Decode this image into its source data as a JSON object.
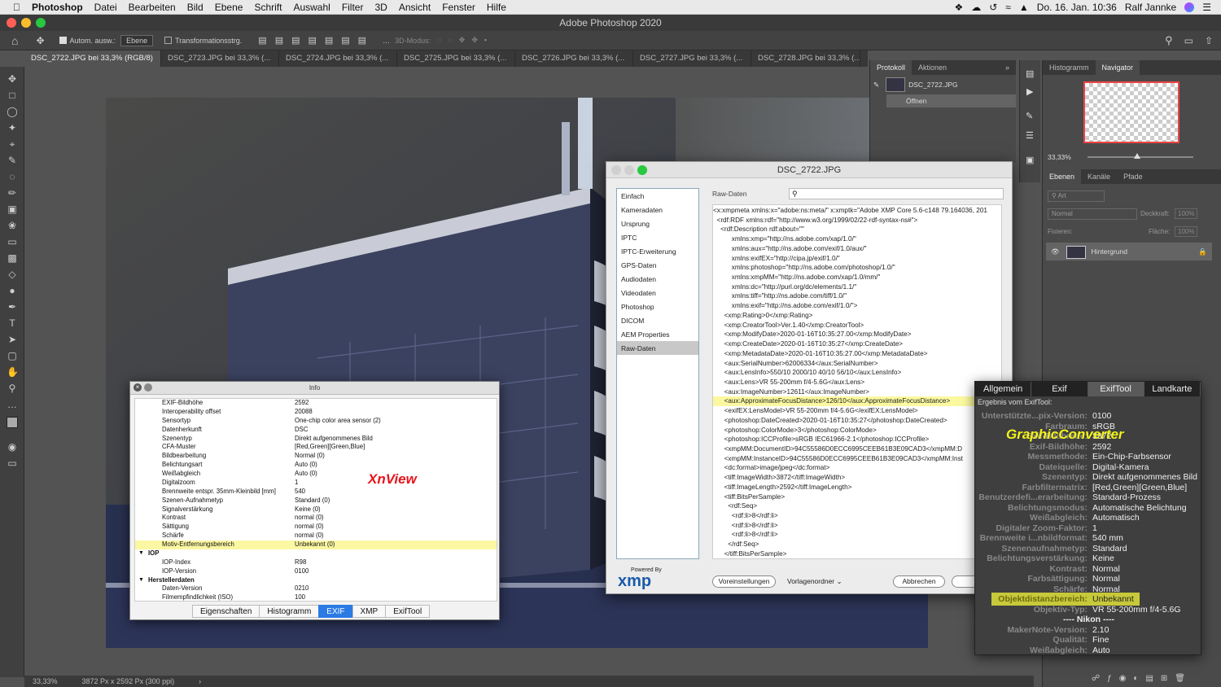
{
  "menubar": {
    "app": "Photoshop",
    "items": [
      "Datei",
      "Bearbeiten",
      "Bild",
      "Ebene",
      "Schrift",
      "Auswahl",
      "Filter",
      "3D",
      "Ansicht",
      "Fenster",
      "Hilfe"
    ],
    "datetime": "Do. 16. Jan. 10:36",
    "user": "Ralf Jannke"
  },
  "window": {
    "title": "Adobe Photoshop 2020"
  },
  "options": {
    "auto_select": "Autom. ausw.:",
    "layer_select": "Ebene",
    "transform": "Transformationsstrg.",
    "mode3d": "3D-Modus:"
  },
  "tabs": [
    "DSC_2722.JPG bei 33,3% (RGB/8)",
    "DSC_2723.JPG bei 33,3% (...",
    "DSC_2724.JPG bei 33,3% (...",
    "DSC_2725.JPG bei 33,3% (...",
    "DSC_2726.JPG bei 33,3% (...",
    "DSC_2727.JPG bei 33,3% (...",
    "DSC_2728.JPG bei 33,3% (..."
  ],
  "status": {
    "zoom": "33,33%",
    "dims": "3872 Px x 2592 Px (300 ppi)"
  },
  "protokoll": {
    "tab1": "Protokoll",
    "tab2": "Aktionen",
    "file": "DSC_2722.JPG",
    "step": "Öffnen"
  },
  "navigator": {
    "tab1": "Histogramm",
    "tab2": "Navigator",
    "zoom": "33,33%"
  },
  "layers": {
    "tabs": [
      "Ebenen",
      "Kanäle",
      "Pfade"
    ],
    "kind": "Art",
    "blend": "Normal",
    "opacity_label": "Deckkraft:",
    "opacity": "100%",
    "lock_label": "Fixieren:",
    "fill_label": "Fläche:",
    "fill": "100%",
    "layer": "Hintergrund"
  },
  "xmp": {
    "title": "DSC_2722.JPG",
    "nav": [
      "Einfach",
      "Kameradaten",
      "Ursprung",
      "IPTC",
      "IPTC-Erweiterung",
      "GPS-Daten",
      "Audiodaten",
      "Videodaten",
      "Photoshop",
      "DICOM",
      "AEM Properties",
      "Raw-Daten"
    ],
    "selected": "Raw-Daten",
    "section": "Raw-Daten",
    "powered": "Powered By",
    "logo": "xmp",
    "btn_prefs": "Voreinstellungen",
    "btn_templates": "Vorlagenordner",
    "btn_cancel": "Abbrechen",
    "lines": [
      "<x:xmpmeta xmlns:x=\"adobe:ns:meta/\" x:xmptk=\"Adobe XMP Core 5.6-c148 79.164036, 201",
      "  <rdf:RDF xmlns:rdf=\"http://www.w3.org/1999/02/22-rdf-syntax-ns#\">",
      "    <rdf:Description rdf:about=\"\"",
      "          xmlns:xmp=\"http://ns.adobe.com/xap/1.0/\"",
      "          xmlns:aux=\"http://ns.adobe.com/exif/1.0/aux/\"",
      "          xmlns:exifEX=\"http://cipa.jp/exif/1.0/\"",
      "          xmlns:photoshop=\"http://ns.adobe.com/photoshop/1.0/\"",
      "          xmlns:xmpMM=\"http://ns.adobe.com/xap/1.0/mm/\"",
      "          xmlns:dc=\"http://purl.org/dc/elements/1.1/\"",
      "          xmlns:tiff=\"http://ns.adobe.com/tiff/1.0/\"",
      "          xmlns:exif=\"http://ns.adobe.com/exif/1.0/\">",
      "      <xmp:Rating>0</xmp:Rating>",
      "      <xmp:CreatorTool>Ver.1.40</xmp:CreatorTool>",
      "      <xmp:ModifyDate>2020-01-16T10:35:27.00</xmp:ModifyDate>",
      "      <xmp:CreateDate>2020-01-16T10:35:27</xmp:CreateDate>",
      "      <xmp:MetadataDate>2020-01-16T10:35:27.00</xmp:MetadataDate>",
      "      <aux:SerialNumber>62006334</aux:SerialNumber>",
      "      <aux:LensInfo>550/10 2000/10 40/10 56/10</aux:LensInfo>",
      "      <aux:Lens>VR 55-200mm f/4-5.6G</aux:Lens>",
      "      <aux:ImageNumber>12611</aux:ImageNumber>",
      "      <aux:ApproximateFocusDistance>126/10</aux:ApproximateFocusDistance>",
      "      <exifEX:LensModel>VR 55-200mm f/4-5.6G</exifEX:LensModel>",
      "      <photoshop:DateCreated>2020-01-16T10:35:27</photoshop:DateCreated>",
      "      <photoshop:ColorMode>3</photoshop:ColorMode>",
      "      <photoshop:ICCProfile>sRGB IEC61966-2.1</photoshop:ICCProfile>",
      "      <xmpMM:DocumentID>94C55586D0ECC6995CEEB61B3E09CAD3</xmpMM:D",
      "      <xmpMM:InstanceID>94C55586D0ECC6995CEEB61B3E09CAD3</xmpMM:Inst",
      "      <dc:format>image/jpeg</dc:format>",
      "      <tiff:ImageWidth>3872</tiff:ImageWidth>",
      "      <tiff:ImageLength>2592</tiff:ImageLength>",
      "      <tiff:BitsPerSample>",
      "        <rdf:Seq>",
      "          <rdf:li>8</rdf:li>",
      "          <rdf:li>8</rdf:li>",
      "          <rdf:li>8</rdf:li>",
      "        </rdf:Seq>",
      "      </tiff:BitsPerSample>"
    ],
    "highlight_line": 20
  },
  "xnview": {
    "title": "Info",
    "label": "XnView",
    "tabs": [
      "Eigenschaften",
      "Histogramm",
      "EXIF",
      "XMP",
      "ExifTool"
    ],
    "active_tab": "EXIF",
    "rows": [
      {
        "k": "EXIF-Bildhöhe",
        "v": "2592"
      },
      {
        "k": "Interoperability offset",
        "v": "20088"
      },
      {
        "k": "Sensortyp",
        "v": "One-chip color area sensor (2)"
      },
      {
        "k": "Datenherkunft",
        "v": "DSC"
      },
      {
        "k": "Szenentyp",
        "v": "Direkt aufgenommenes Bild"
      },
      {
        "k": "CFA-Muster",
        "v": "[Red,Green][Green,Blue]"
      },
      {
        "k": "Bildbearbeitung",
        "v": "Normal (0)"
      },
      {
        "k": "Belichtungsart",
        "v": "Auto (0)"
      },
      {
        "k": "Weißabgleich",
        "v": "Auto (0)"
      },
      {
        "k": "Digitalzoom",
        "v": "1"
      },
      {
        "k": "Brennweite entspr. 35mm-Kleinbild [mm]",
        "v": "540"
      },
      {
        "k": "Szenen-Aufnahmetyp",
        "v": "Standard (0)"
      },
      {
        "k": "Signalverstärkung",
        "v": "Keine (0)"
      },
      {
        "k": "Kontrast",
        "v": "normal (0)"
      },
      {
        "k": "Sättigung",
        "v": "normal (0)"
      },
      {
        "k": "Schärfe",
        "v": "normal (0)"
      },
      {
        "k": "Motiv-Entfernungsbereich",
        "v": "Unbekannt (0)",
        "hl": true
      },
      {
        "k": "IOP",
        "v": "",
        "grp": true
      },
      {
        "k": "IOP-Index",
        "v": "R98"
      },
      {
        "k": "IOP-Version",
        "v": "0100"
      },
      {
        "k": "Herstellerdaten",
        "v": "",
        "grp": true
      },
      {
        "k": "Daten-Version",
        "v": "0210"
      },
      {
        "k": "Filmempfindlichkeit (ISO)",
        "v": "100"
      }
    ]
  },
  "gc": {
    "label": "GraphicConverter",
    "tabs": [
      "Allgemein",
      "Exif",
      "ExifTool",
      "Landkarte"
    ],
    "active_tab": "ExifTool",
    "subtitle": "Ergebnis vom ExifTool:",
    "rows": [
      {
        "k": "Unterstützte...pix-Version:",
        "v": "0100"
      },
      {
        "k": "Farbraum:",
        "v": "sRGB"
      },
      {
        "k": "Exif-Bildbreite:",
        "v": "3872"
      },
      {
        "k": "Exif-Bildhöhe:",
        "v": "2592"
      },
      {
        "k": "Messmethode:",
        "v": "Ein-Chip-Farbsensor"
      },
      {
        "k": "Dateiquelle:",
        "v": "Digital-Kamera"
      },
      {
        "k": "Szenentyp:",
        "v": "Direkt aufgenommenes Bild"
      },
      {
        "k": "Farbfiltermatrix:",
        "v": "[Red,Green][Green,Blue]"
      },
      {
        "k": "Benutzerdefi...erarbeitung:",
        "v": "Standard-Prozess"
      },
      {
        "k": "Belichtungsmodus:",
        "v": "Automatische Belichtung"
      },
      {
        "k": "Weißabgleich:",
        "v": "Automatisch"
      },
      {
        "k": "Digitaler Zoom-Faktor:",
        "v": "1"
      },
      {
        "k": "Brennweite i...nbildformat:",
        "v": "540 mm"
      },
      {
        "k": "Szenenaufnahmetyp:",
        "v": "Standard"
      },
      {
        "k": "Belichtungsverstärkung:",
        "v": "Keine"
      },
      {
        "k": "Kontrast:",
        "v": "Normal"
      },
      {
        "k": "Farbsättigung:",
        "v": "Normal"
      },
      {
        "k": "Schärfe:",
        "v": "Normal"
      },
      {
        "k": "Objektdistanzbereich:",
        "v": "Unbekannt",
        "hl": true
      },
      {
        "k": "Objektiv-Typ:",
        "v": "VR 55-200mm f/4-5.6G"
      },
      {
        "k": "---- Nikon ----",
        "v": "",
        "hd": true
      },
      {
        "k": "MakerNote-Version:",
        "v": "2.10"
      },
      {
        "k": "Qualität:",
        "v": "Fine"
      },
      {
        "k": "Weißabgleich:",
        "v": "Auto"
      }
    ]
  },
  "colors": {
    "highlight": "#e0e23a",
    "accent": "#2c7be5",
    "label_red": "#e8141c",
    "label_yellow": "#f2f21a"
  }
}
